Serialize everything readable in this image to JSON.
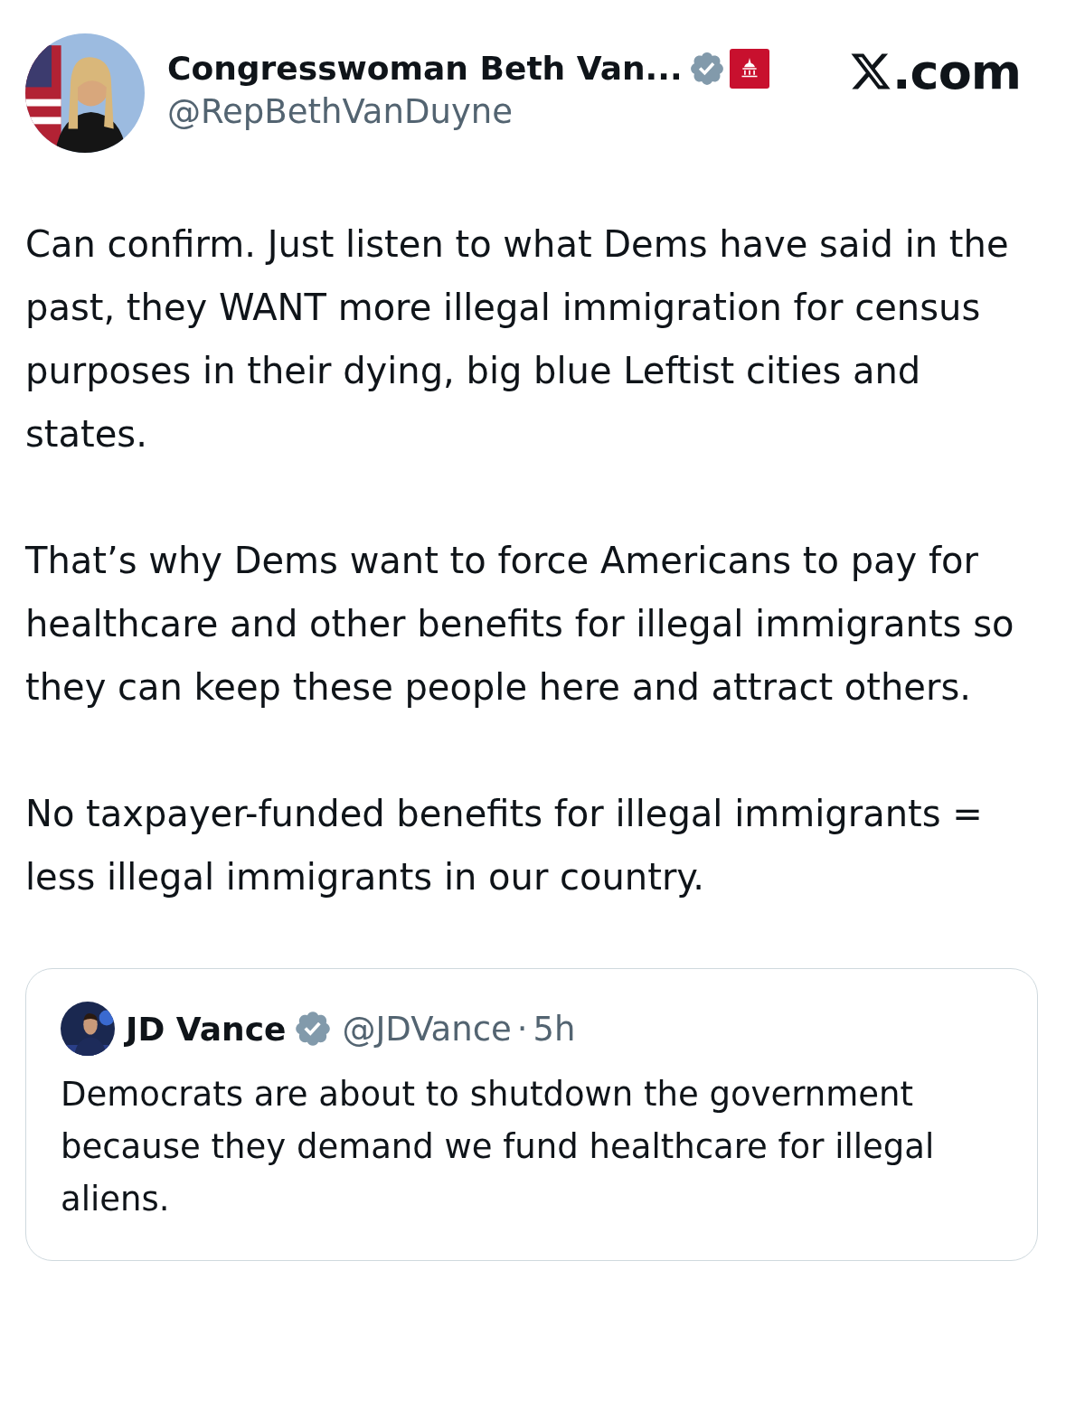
{
  "post": {
    "author": "Congresswoman Beth Van...",
    "handle": "@RepBethVanDuyne",
    "verified": true,
    "affiliation_badge": true,
    "paragraphs": [
      "Can confirm. Just listen to what Dems have said in the past, they WANT more illegal immigration for census purposes in their dying, big blue Leftist cities and states.",
      "That’s why Dems want to force Americans to pay for healthcare and other benefits for illegal immigrants so they can keep these people here and attract others.",
      "No taxpayer-funded benefits for illegal immigrants = less illegal immigrants in our country."
    ]
  },
  "site_label": ".com",
  "quoted_post": {
    "author": "JD Vance",
    "verified": true,
    "handle": "@JDVance",
    "separator": "·",
    "time": "5h",
    "text": "Democrats are about to shutdown the government because they demand we fund healthcare for illegal aliens."
  }
}
